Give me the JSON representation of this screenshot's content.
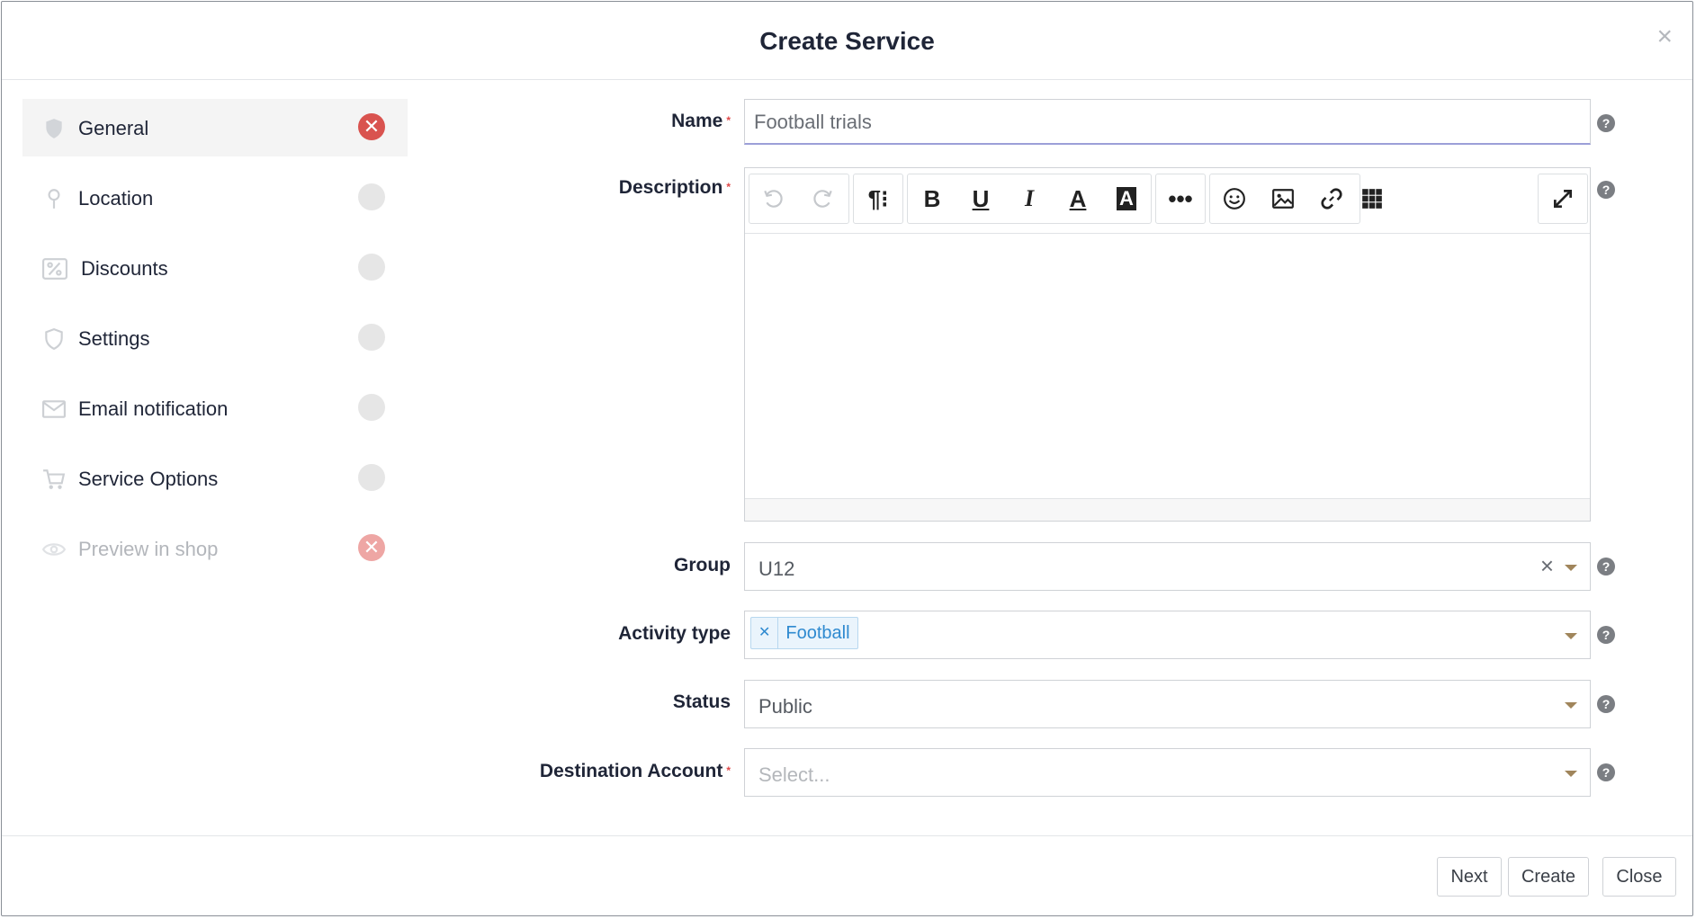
{
  "dialog": {
    "title": "Create Service",
    "close_glyph": "×"
  },
  "sidebar": {
    "items": [
      {
        "label": "General",
        "icon": "shield-icon",
        "status": "error"
      },
      {
        "label": "Location",
        "icon": "map-pin-icon",
        "status": "empty"
      },
      {
        "label": "Discounts",
        "icon": "discount-icon",
        "status": "empty"
      },
      {
        "label": "Settings",
        "icon": "shield-icon",
        "status": "empty"
      },
      {
        "label": "Email notification",
        "icon": "envelope-icon",
        "status": "empty"
      },
      {
        "label": "Service Options",
        "icon": "cart-icon",
        "status": "empty"
      },
      {
        "label": "Preview in shop",
        "icon": "eye-icon",
        "status": "error-faded"
      }
    ]
  },
  "form": {
    "name": {
      "label": "Name",
      "value": "Football trials"
    },
    "description": {
      "label": "Description"
    },
    "group": {
      "label": "Group",
      "value": "U12"
    },
    "activity_type": {
      "label": "Activity type",
      "tag": "Football"
    },
    "status": {
      "label": "Status",
      "value": "Public"
    },
    "destination_account": {
      "label": "Destination Account",
      "placeholder": "Select..."
    },
    "required_marker": "*",
    "help_glyph": "?"
  },
  "footer": {
    "next_label": "Next",
    "create_label": "Create",
    "close_label": "Close"
  },
  "colors": {
    "error": "#d9534f",
    "focus": "#9c9fd8",
    "tag": "#2f8ad0"
  }
}
